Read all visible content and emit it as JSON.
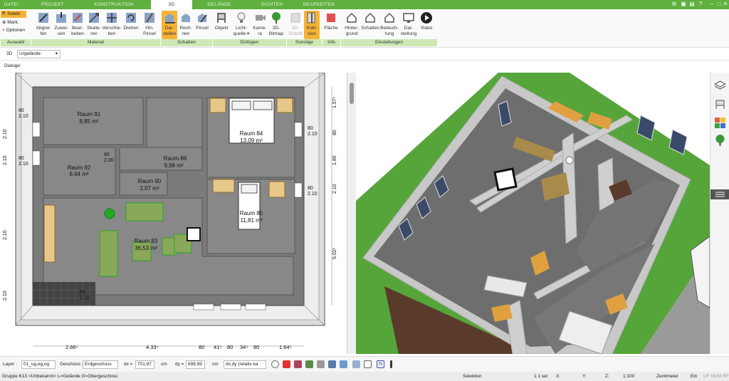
{
  "tabs": [
    {
      "label": "DATEI",
      "active": false
    },
    {
      "label": "PROJEKT",
      "active": false
    },
    {
      "label": "KONSTRUKTION",
      "active": false
    },
    {
      "label": "3D",
      "active": true
    },
    {
      "label": "GELÄNDE",
      "active": false
    },
    {
      "label": "SICHTEN",
      "active": false
    },
    {
      "label": "BEARBEITEN",
      "active": false
    }
  ],
  "ribbon": {
    "select": {
      "selekt": "Selekt",
      "mark": "Mark.",
      "optionen": "Optionen",
      "group": "Auswahl"
    },
    "material": {
      "group": "Material",
      "buttons": [
        [
          "Abgrei-",
          "fen"
        ],
        [
          "Zuwei-",
          "sen"
        ],
        [
          "Bear-",
          "beiten"
        ],
        [
          "Skalie-",
          "ren"
        ],
        [
          "Verschie-",
          "ben"
        ],
        [
          "Drehen",
          ""
        ],
        [
          "Hin.",
          "Pinsel"
        ]
      ]
    },
    "schatten": {
      "group": "Schatten",
      "buttons": [
        [
          "Dar-",
          "stellen"
        ],
        [
          "Rech-",
          "nen"
        ],
        [
          "Pinsel",
          ""
        ]
      ]
    },
    "einfuegen": {
      "group": "Einfügen",
      "buttons": [
        [
          "Objekt",
          ""
        ],
        [
          "Licht-",
          "quelle ▾"
        ],
        [
          "Kame-",
          "ra"
        ],
        [
          "3D-",
          "Bitmap"
        ]
      ]
    },
    "sonstige": {
      "group": "Sonstige",
      "buttons": [
        [
          "3D-",
          "Schnitt"
        ],
        [
          "Kolli-",
          "sion"
        ]
      ]
    },
    "info": {
      "group": "Info",
      "buttons": [
        [
          "Fläche",
          ""
        ]
      ]
    },
    "einstellungen": {
      "group": "Einstellungen",
      "buttons": [
        [
          "Hinter-",
          "grund"
        ],
        [
          "Schatten",
          ""
        ],
        [
          "Beleuch-",
          "tung"
        ],
        [
          "Dar-",
          "stellung"
        ],
        [
          "Video",
          ""
        ]
      ]
    }
  },
  "viewbar": {
    "mode": "3D",
    "terrain": "Urgelände",
    "dialog_label": "Dialoge:"
  },
  "plan": {
    "rooms": [
      {
        "name": "Raum 91",
        "area": "8,85 m²"
      },
      {
        "name": "Raum 92",
        "area": "6,64 m²"
      },
      {
        "name": "Raum 90",
        "area": "2,07 m²"
      },
      {
        "name": "Raum 86",
        "area": "9,98 m²"
      },
      {
        "name": "Raum 84",
        "area": "13,09 m²"
      },
      {
        "name": "Raum 85",
        "area": "11,81 m²"
      },
      {
        "name": "Raum 83",
        "area": "36,53 m²"
      }
    ],
    "bottom_dims": [
      "2.66⁵",
      "4.33⁵",
      "80",
      "41⁵",
      "80",
      "34⁵",
      "80",
      "1.64⁵"
    ],
    "right_dims": [
      "1.57⁵",
      "80",
      "2.10",
      "1.80",
      "2.10",
      "5.02⁵"
    ],
    "left_dims": [
      "2.10",
      "2.10",
      "2.10",
      "2.10"
    ],
    "win_labels": [
      "80",
      "2.10"
    ],
    "door_labels": [
      "80",
      "2.00"
    ]
  },
  "bottombar": {
    "layer_label": "Layer :",
    "layer_value": "01_ug,eg,og",
    "geschoss_label": "Geschoss :",
    "geschoss_value": "Erdgeschoss",
    "dx_label": "dx =",
    "dx_value": "701,97",
    "dy_label": "dy =",
    "dy_value": "698,99",
    "unit": "cm",
    "relative": "dx,dy (relativ ka"
  },
  "status": {
    "group": "Gruppe K13 <Unbekannt> L=Gelände G=Obergeschoss",
    "mode": "Selektion",
    "sel": "1:1 sel",
    "x": "X:",
    "y": "Y:",
    "z": "Z:",
    "scale": "1:100",
    "unit": "Zentimeter",
    "ein": "Ein",
    "flags": "UF NUM RF"
  },
  "colors": {
    "accent": "#5fb03f",
    "group_bg": "#cde8b4",
    "selected": "#f5b335",
    "floor": "#888888",
    "wall": "#d8d8d8",
    "grass": "#58a83a"
  }
}
